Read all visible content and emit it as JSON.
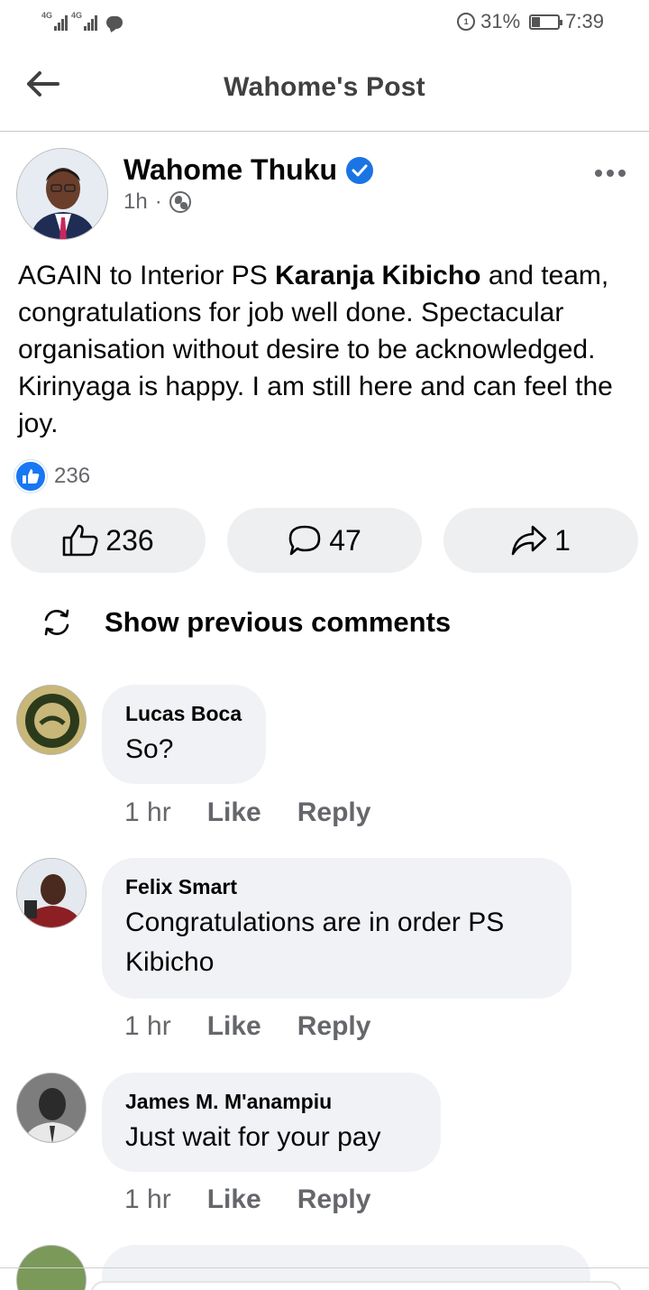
{
  "status_bar": {
    "network_1": "4G",
    "network_2": "4G",
    "battery_percent": "31%",
    "time": "7:39",
    "battery_level": 0.31,
    "icons": [
      "signal-icon",
      "signal-icon",
      "message-notification-icon",
      "data-saver-icon",
      "battery-icon"
    ]
  },
  "header": {
    "title": "Wahome's Post",
    "back_icon": "arrow-left-icon"
  },
  "post": {
    "author": "Wahome Thuku",
    "verified": true,
    "time": "1h",
    "separator": "·",
    "audience_icon": "globe-icon",
    "text_parts": {
      "before": "AGAIN to Interior PS ",
      "bold": "Karanja Kibicho",
      "after": " and team, congratulations for job well done. Spectacular organisation without desire to be acknowledged. Kirinyaga is happy. I am still here and can feel the joy."
    },
    "reaction_count": "236",
    "actions": {
      "like_count": "236",
      "comment_count": "47",
      "share_count": "1"
    }
  },
  "show_previous": "Show previous comments",
  "comments": [
    {
      "name": "Lucas Boca",
      "text": "So?",
      "time": "1 hr",
      "like": "Like",
      "reply": "Reply"
    },
    {
      "name": "Felix Smart",
      "text": "Congratulations are in order PS Kibicho",
      "time": "1 hr",
      "like": "Like",
      "reply": "Reply"
    },
    {
      "name": "James M. M'anampiu",
      "text": "Just wait for your pay",
      "time": "1 hr",
      "like": "Like",
      "reply": "Reply"
    }
  ],
  "colors": {
    "accent": "#1877f2",
    "verified": "#1b74e4",
    "muted_text": "#65676b",
    "bubble": "#f0f2f5"
  }
}
